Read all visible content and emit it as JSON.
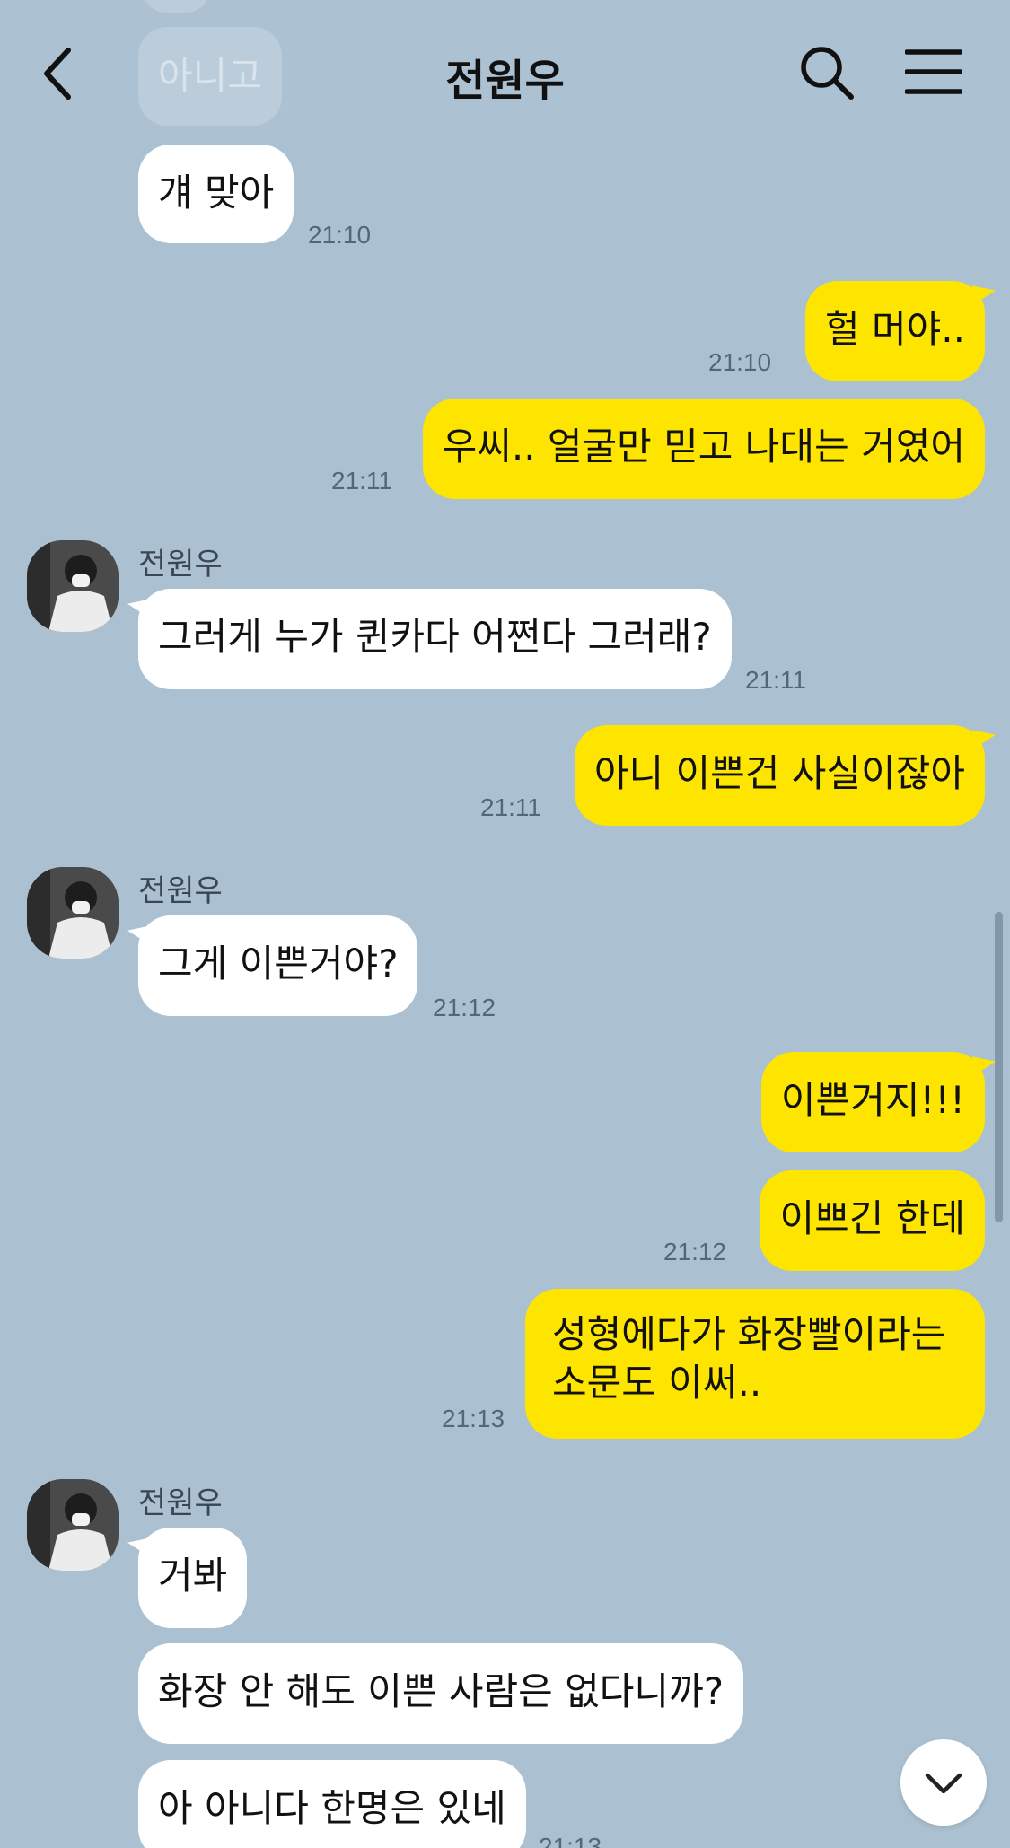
{
  "header": {
    "title": "전원우",
    "faded_previous_message": "아니고"
  },
  "messages": [
    {
      "id": "m1",
      "direction": "in",
      "text": "걔 맞아",
      "time": "21:10"
    },
    {
      "id": "m2",
      "direction": "out",
      "text": "헐 머야..",
      "time": "21:10"
    },
    {
      "id": "m3",
      "direction": "out",
      "text": "우씨.. 얼굴만 믿고 나대는 거였어",
      "time": "21:11"
    },
    {
      "id": "m4",
      "direction": "in",
      "sender": "전원우",
      "text": "그러게 누가 퀸카다 어쩐다 그러래?",
      "time": "21:11"
    },
    {
      "id": "m5",
      "direction": "out",
      "text": "아니 이쁜건 사실이잖아",
      "time": "21:11"
    },
    {
      "id": "m6",
      "direction": "in",
      "sender": "전원우",
      "text": "그게 이쁜거야?",
      "time": "21:12"
    },
    {
      "id": "m7",
      "direction": "out",
      "text": "이쁜거지!!!"
    },
    {
      "id": "m8",
      "direction": "out",
      "text": "이쁘긴 한데",
      "time": "21:12"
    },
    {
      "id": "m9",
      "direction": "out",
      "text_line1": "성형에다가 화장빨이라는",
      "text_line2": "소문도 이써..",
      "time": "21:13"
    },
    {
      "id": "m10",
      "direction": "in",
      "sender": "전원우",
      "text": "거봐"
    },
    {
      "id": "m11",
      "direction": "in",
      "text": "화장 안 해도 이쁜 사람은 없다니까?"
    },
    {
      "id": "m12",
      "direction": "in",
      "text": "아 아니다 한명은 있네",
      "time": "21:13"
    }
  ],
  "colors": {
    "background": "#abc1d1",
    "incoming_bubble": "#ffffff",
    "outgoing_bubble": "#fee500"
  },
  "icons": {
    "back": "chevron-left-icon",
    "search": "search-icon",
    "menu": "hamburger-menu-icon",
    "scroll_down": "chevron-down-icon"
  }
}
